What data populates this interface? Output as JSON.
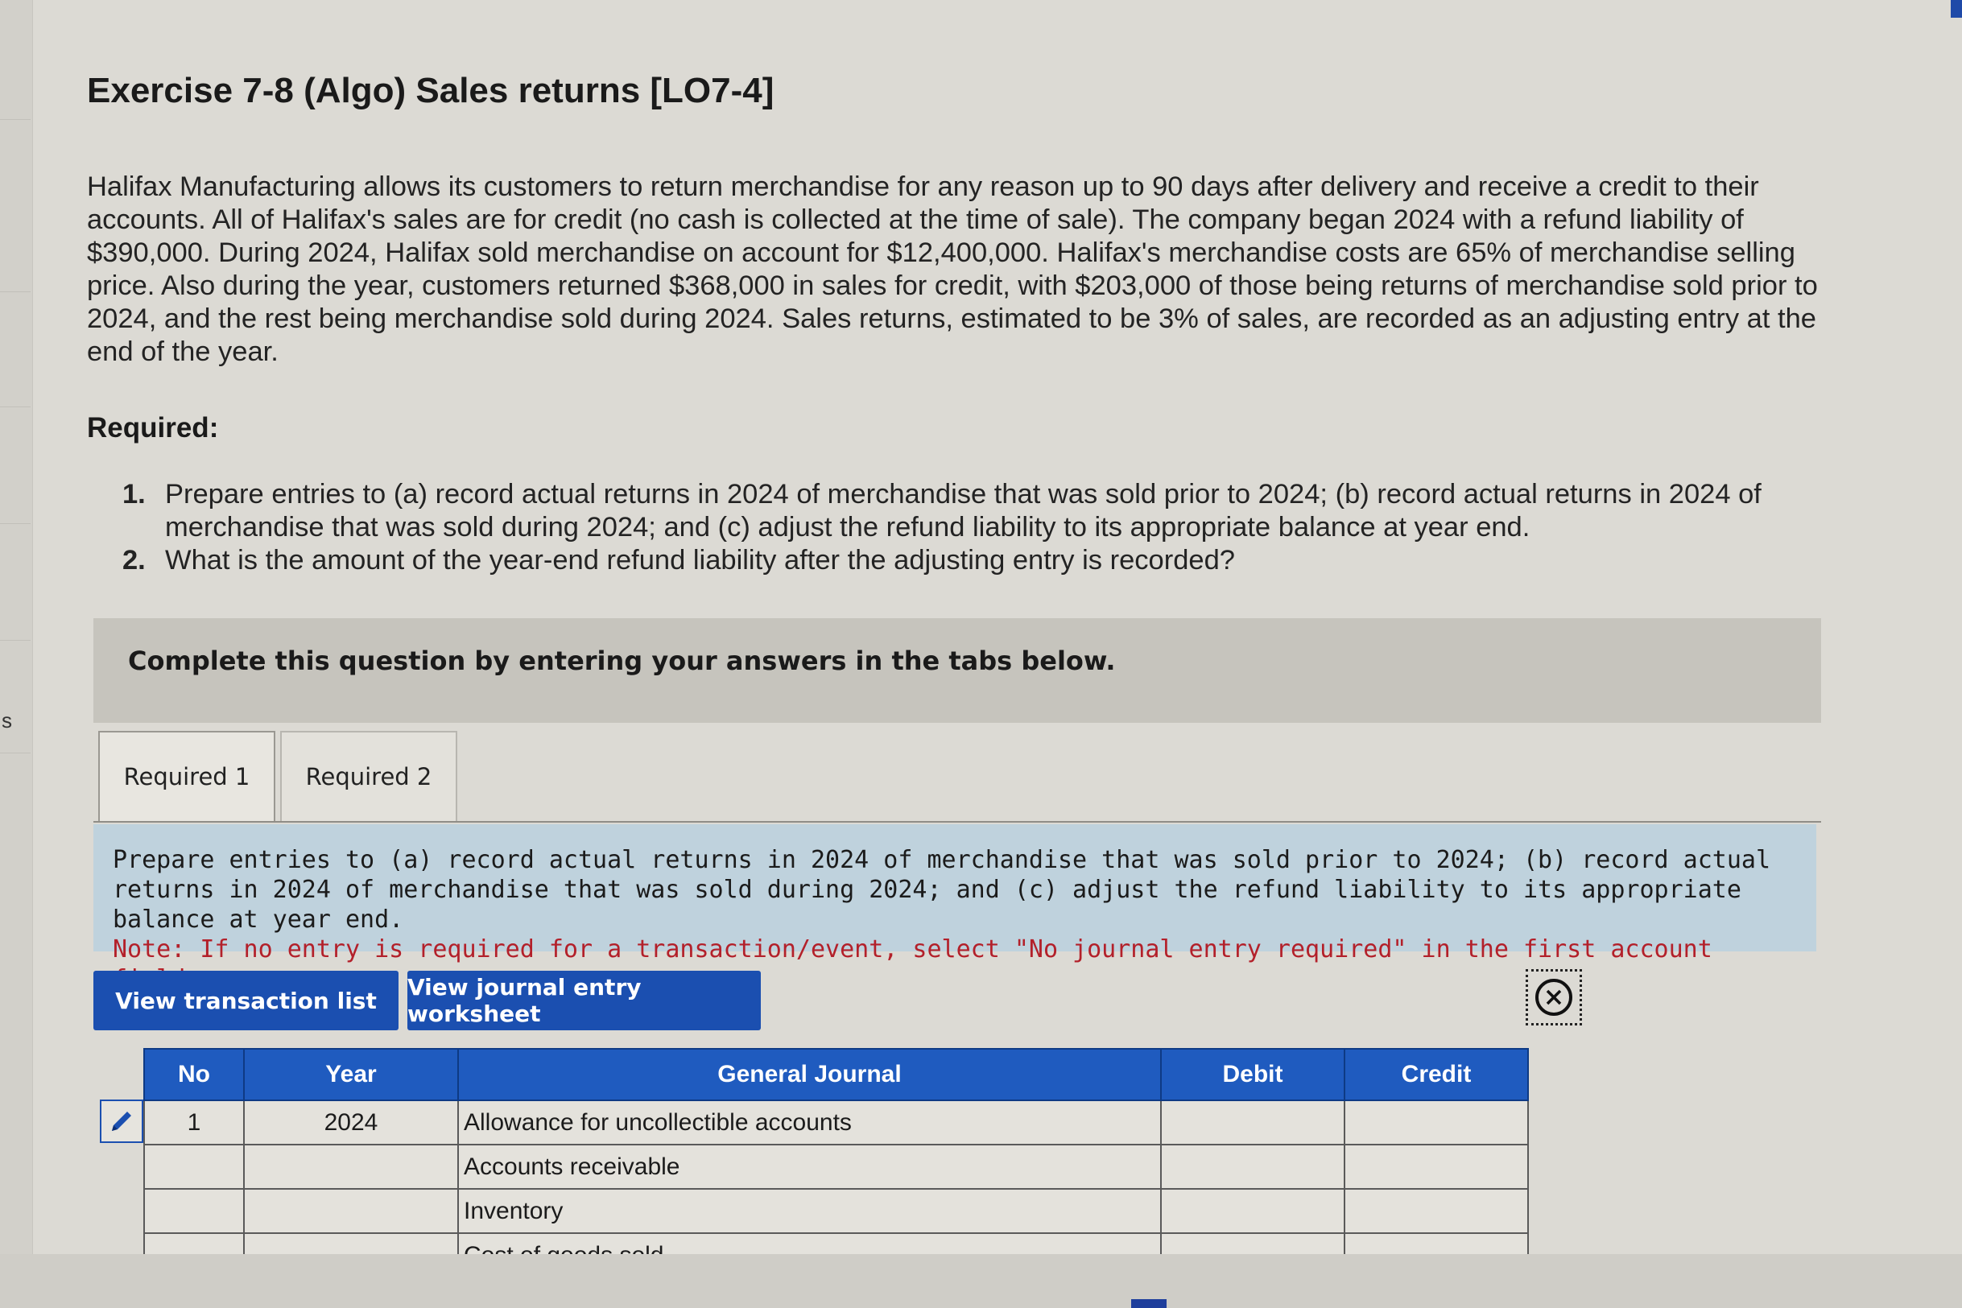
{
  "exercise": {
    "title": "Exercise 7-8 (Algo) Sales returns [LO7-4]",
    "intro": "Halifax Manufacturing allows its customers to return merchandise for any reason up to 90 days after delivery and receive a credit to their accounts. All of Halifax's sales are for credit (no cash is collected at the time of sale). The company began 2024 with a refund liability of $390,000. During 2024, Halifax sold merchandise on account for $12,400,000. Halifax's merchandise costs are 65% of merchandise selling price. Also during the year, customers returned $368,000 in sales for credit, with $203,000 of those being returns of merchandise sold prior to 2024, and the rest being merchandise sold during 2024. Sales returns, estimated to be 3% of sales, are recorded as an adjusting entry at the end of the year."
  },
  "required": {
    "heading": "Required:",
    "items": [
      {
        "num": "1.",
        "text": "Prepare entries to (a) record actual returns in 2024 of merchandise that was sold prior to 2024; (b) record actual returns in 2024 of merchandise that was sold during 2024; and (c) adjust the refund liability to its appropriate balance at year end."
      },
      {
        "num": "2.",
        "text": "What is the amount of the year-end refund liability after the adjusting entry is recorded?"
      }
    ]
  },
  "complete_banner": "Complete this question by entering your answers in the tabs below.",
  "tabs": [
    {
      "label": "Required 1",
      "active": true
    },
    {
      "label": "Required 2",
      "active": false
    }
  ],
  "instructions": {
    "text": "Prepare entries to (a) record actual returns in 2024 of merchandise that was sold prior to 2024; (b) record actual returns in 2024 of merchandise that was sold during 2024; and (c) adjust the refund liability to its appropriate balance at year end.",
    "note": "Note: If no entry is required for a transaction/event, select \"No journal entry required\" in the first account field."
  },
  "buttons": {
    "transaction_list": "View transaction list",
    "worksheet": "View journal entry worksheet"
  },
  "journal": {
    "headers": [
      "No",
      "Year",
      "General Journal",
      "Debit",
      "Credit"
    ],
    "rows": [
      {
        "no": "1",
        "year": "2024",
        "account": "Allowance for uncollectible accounts",
        "debit": "",
        "credit": ""
      },
      {
        "no": "",
        "year": "",
        "account": "Accounts receivable",
        "debit": "",
        "credit": ""
      },
      {
        "no": "",
        "year": "",
        "account": "Inventory",
        "debit": "",
        "credit": ""
      },
      {
        "no": "",
        "year": "",
        "account": "Cost of goods sold",
        "debit": "",
        "credit": ""
      }
    ]
  },
  "side_letter": "s",
  "colors": {
    "button_blue": "#1b4fb0",
    "header_blue": "#1f5bbf",
    "note_red": "#b3202a",
    "instruction_bg": "#bfd2dd"
  },
  "icons": [
    "edit-pencil-icon",
    "close-circle-icon"
  ]
}
